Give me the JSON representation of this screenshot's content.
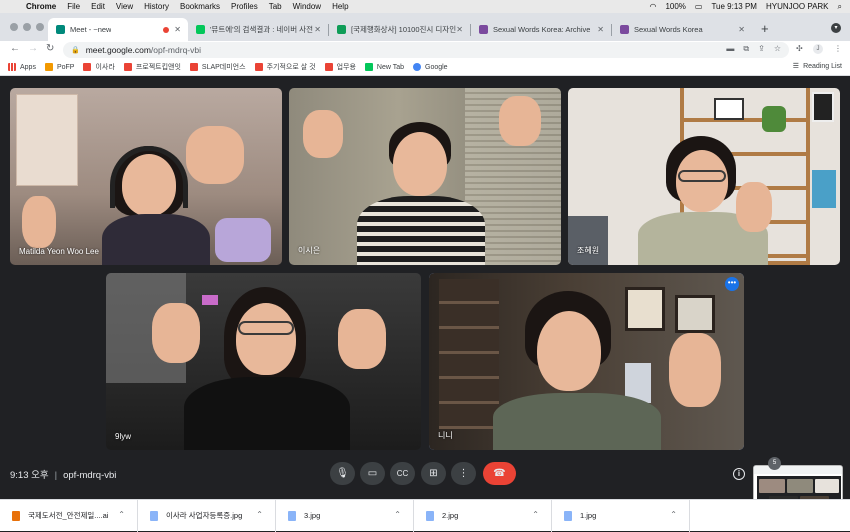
{
  "menubar": {
    "app": "Chrome",
    "items": [
      "File",
      "Edit",
      "View",
      "History",
      "Bookmarks",
      "Profiles",
      "Tab",
      "Window",
      "Help"
    ],
    "battery": "100%",
    "clock": "Tue 9:13 PM",
    "user": "HYUNJOO PARK"
  },
  "tabs": [
    {
      "title": "Meet - ~new",
      "active": true,
      "favicon_color": "#00897b"
    },
    {
      "title": "'뮤트에'의 검색결과 : 네이버 사전",
      "active": false,
      "favicon_color": "#03c75a"
    },
    {
      "title": "[국제행화상사] 10100진시 디자인 -",
      "active": false,
      "favicon_color": "#0f9d58"
    },
    {
      "title": "Sexual Words Korea: Archive",
      "active": false,
      "favicon_color": "#7b4a9e"
    },
    {
      "title": "Sexual Words Korea",
      "active": false,
      "favicon_color": "#7b4a9e"
    }
  ],
  "address": {
    "host": "meet.google.com",
    "path": "/opf-mdrq-vbi"
  },
  "bookmarks": [
    {
      "label": "Apps",
      "color": "#ea4335"
    },
    {
      "label": "PoFP",
      "color": "#f29900"
    },
    {
      "label": "이사라",
      "color": "#ea4335"
    },
    {
      "label": "프로젝트킵앤잇",
      "color": "#ea4335"
    },
    {
      "label": "SLAP데미언스",
      "color": "#ea4335"
    },
    {
      "label": "주기적으로 살 것",
      "color": "#ea4335"
    },
    {
      "label": "업무용",
      "color": "#ea4335"
    },
    {
      "label": "New Tab",
      "color": "#03c75a"
    },
    {
      "label": "Google",
      "color": "#4285f4"
    }
  ],
  "reading_list": "Reading List",
  "participants": [
    {
      "name": "Matilda Yeon Woo Lee"
    },
    {
      "name": "이시은"
    },
    {
      "name": "조혜원"
    },
    {
      "name": "9lyw"
    },
    {
      "name": "니니"
    }
  ],
  "callbar": {
    "time": "9:13 오후",
    "meeting_code": "opf-mdrq-vbi"
  },
  "mini_badge": "5",
  "downloads": [
    {
      "name": "국제도서전_안전제일....ai",
      "icon_color": "#e8710a"
    },
    {
      "name": "이사라 사업자등록증.jpg",
      "icon_color": "#8ab4f8"
    },
    {
      "name": "3.jpg",
      "icon_color": "#8ab4f8"
    },
    {
      "name": "2.jpg",
      "icon_color": "#8ab4f8"
    },
    {
      "name": "1.jpg",
      "icon_color": "#8ab4f8"
    }
  ]
}
